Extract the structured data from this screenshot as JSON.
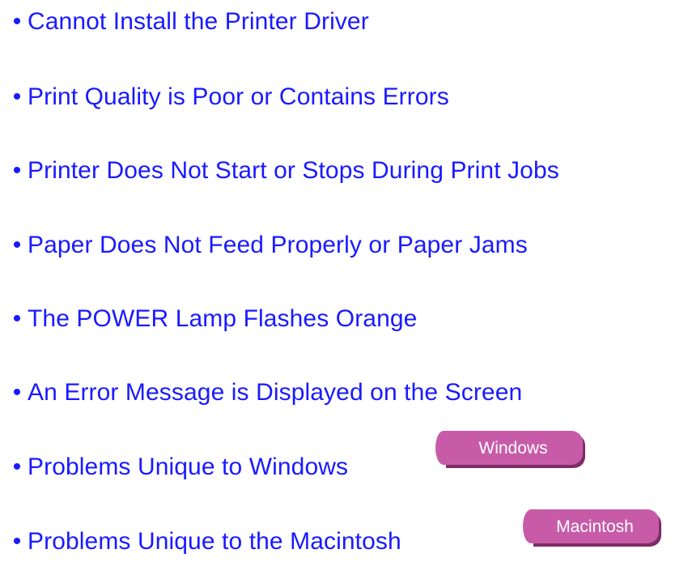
{
  "topics": [
    {
      "label": "Cannot Install the Printer Driver"
    },
    {
      "label": "Print Quality is Poor or Contains Errors"
    },
    {
      "label": "Printer Does Not Start or Stops During Print Jobs"
    },
    {
      "label": "Paper Does Not Feed Properly or Paper Jams"
    },
    {
      "label": "The POWER Lamp Flashes Orange"
    },
    {
      "label": "An Error Message is Displayed on the Screen"
    },
    {
      "label": "Problems Unique to Windows",
      "badge": "Windows"
    },
    {
      "label": "Problems Unique to the Macintosh",
      "badge": "Macintosh"
    }
  ],
  "bullet_glyph": "•",
  "colors": {
    "link_text": "#1a1aff",
    "badge_fill": "#c85ba8",
    "badge_shadow": "#7e2d66",
    "badge_text": "#ffffff",
    "background": "#ffffff"
  }
}
